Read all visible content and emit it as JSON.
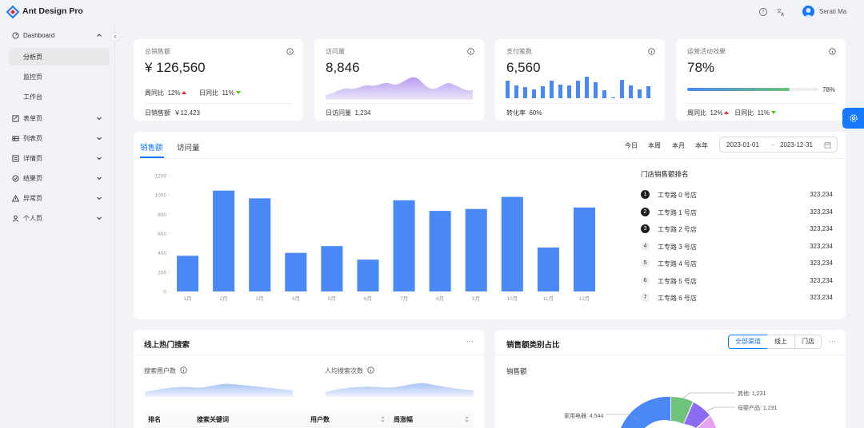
{
  "header": {
    "brand": "Ant Design Pro",
    "user_name": "Serati Ma",
    "icons": [
      "question-icon",
      "translate-icon"
    ]
  },
  "sidebar": {
    "items": [
      {
        "label": "Dashboard",
        "icon": "dashboard-icon",
        "expanded": true
      },
      {
        "label": "分析页",
        "sub": true,
        "active": true
      },
      {
        "label": "监控页",
        "sub": true
      },
      {
        "label": "工作台",
        "sub": true
      },
      {
        "label": "表单页",
        "icon": "form-icon"
      },
      {
        "label": "列表页",
        "icon": "table-icon"
      },
      {
        "label": "详情页",
        "icon": "profile-icon"
      },
      {
        "label": "结果页",
        "icon": "check-circle-icon"
      },
      {
        "label": "异常页",
        "icon": "warning-icon"
      },
      {
        "label": "个人页",
        "icon": "user-icon"
      }
    ]
  },
  "stats": {
    "sales": {
      "title": "总销售额",
      "value": "¥ 126,560",
      "week_label": "周同比",
      "week_value": "12%",
      "day_label": "日同比",
      "day_value": "11%",
      "footer_label": "日销售额",
      "footer_value": "￥12,423"
    },
    "visits": {
      "title": "访问量",
      "value": "8,846",
      "footer_label": "日访问量",
      "footer_value": "1,234"
    },
    "payments": {
      "title": "支付笔数",
      "value": "6,560",
      "footer_label": "转化率",
      "footer_value": "60%"
    },
    "campaign": {
      "title": "运营活动效果",
      "value": "78%",
      "progress": 0.78,
      "progress_label": "78%",
      "week_label": "周同比",
      "week_value": "12%",
      "day_label": "日同比",
      "day_value": "11%"
    }
  },
  "sales_panel": {
    "tabs": [
      "销售额",
      "访问量"
    ],
    "ranges": [
      "今日",
      "本周",
      "本月",
      "本年"
    ],
    "date_start": "2023-01-01",
    "date_end": "2023-12-31",
    "ranking_title": "门店销售额排名",
    "ranking": [
      {
        "rank": "1",
        "name": "工专路 0 号店",
        "value": "323,234"
      },
      {
        "rank": "2",
        "name": "工专路 1 号店",
        "value": "323,234"
      },
      {
        "rank": "3",
        "name": "工专路 2 号店",
        "value": "323,234"
      },
      {
        "rank": "4",
        "name": "工专路 3 号店",
        "value": "323,234"
      },
      {
        "rank": "5",
        "name": "工专路 4 号店",
        "value": "323,234"
      },
      {
        "rank": "6",
        "name": "工专路 5 号店",
        "value": "323,234"
      },
      {
        "rank": "7",
        "name": "工专路 6 号店",
        "value": "323,234"
      }
    ]
  },
  "chart_data": {
    "type": "bar",
    "categories": [
      "1月",
      "2月",
      "3月",
      "4月",
      "5月",
      "6月",
      "7月",
      "8月",
      "9月",
      "10月",
      "11月",
      "12月"
    ],
    "values": [
      370,
      1045,
      965,
      400,
      470,
      330,
      945,
      835,
      855,
      980,
      455,
      870
    ],
    "yticks": [
      "0",
      "200",
      "400",
      "600",
      "800",
      "1000",
      "1200"
    ],
    "ylim": [
      0,
      1200
    ],
    "color": "#4a88f7"
  },
  "search_panel": {
    "title": "线上热门搜索",
    "more": "···",
    "metric1_label": "搜索用户数",
    "metric2_label": "人均搜索次数",
    "columns": [
      "排名",
      "搜索关键词",
      "用户数",
      "周涨幅"
    ]
  },
  "category_panel": {
    "title": "销售额类别占比",
    "more": "···",
    "segments": [
      "全部渠道",
      "线上",
      "门店"
    ],
    "subtitle": "销售额",
    "labels": [
      "其他: 1,231",
      "母婴产品: 1,231",
      "家用电器: 4,544"
    ]
  },
  "colors": {
    "primary": "#1677ff",
    "bar": "#4a88f7",
    "up": "#f5222d",
    "down": "#52c41a"
  }
}
